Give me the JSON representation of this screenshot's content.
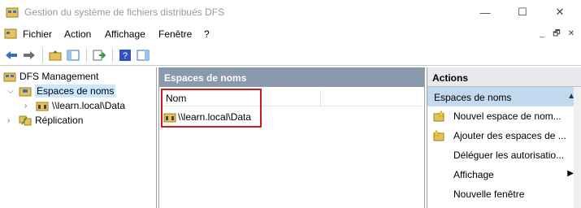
{
  "window": {
    "title": "Gestion du système de fichiers distribués DFS",
    "minimize_glyph": "—",
    "maximize_glyph": "☐",
    "close_glyph": "✕"
  },
  "menu": {
    "items": [
      "Fichier",
      "Action",
      "Affichage",
      "Fenêtre",
      "?"
    ]
  },
  "tree": {
    "root": "DFS Management",
    "namespaces": "Espaces de noms",
    "namespace_child": "\\\\learn.local\\Data",
    "replication": "Réplication"
  },
  "center": {
    "header": "Espaces de noms",
    "column_name": "Nom",
    "rows": [
      "\\\\learn.local\\Data"
    ]
  },
  "actions": {
    "header": "Actions",
    "section": "Espaces de noms",
    "items": [
      {
        "label": "Nouvel espace de nom...",
        "icon": "new-namespace-icon"
      },
      {
        "label": "Ajouter des espaces de ...",
        "icon": "add-namespace-icon"
      },
      {
        "label": "Déléguer les autorisatio...",
        "icon": ""
      },
      {
        "label": "Affichage",
        "icon": "",
        "submenu": true
      },
      {
        "label": "Nouvelle fenêtre",
        "icon": ""
      }
    ]
  },
  "colors": {
    "pane_header": "#8a9aac",
    "selection": "#cce8ff",
    "actions_section": "#c3d9ef",
    "highlight_border": "#d11a1a"
  }
}
